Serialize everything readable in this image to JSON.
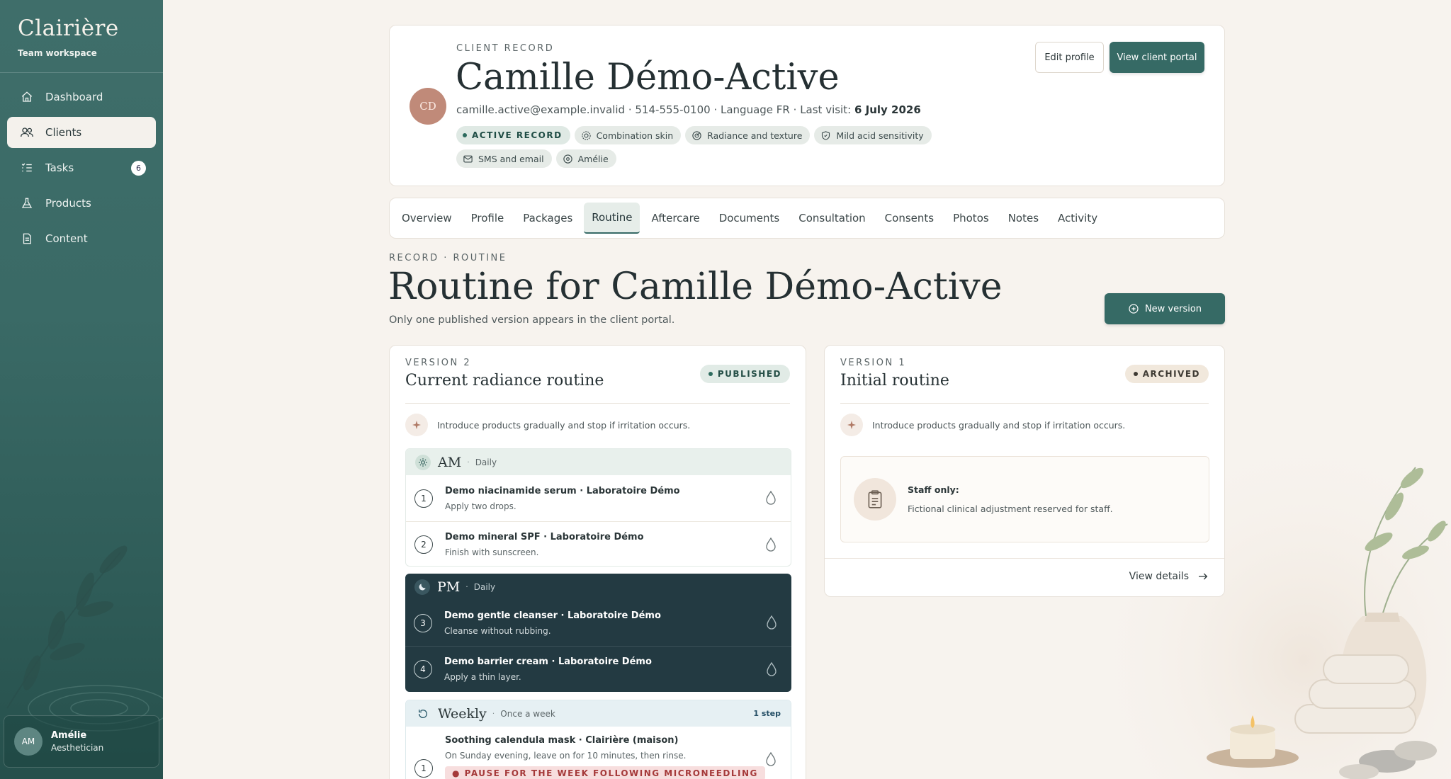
{
  "sidebar": {
    "brand": "Clairière",
    "workspace": "Team workspace",
    "items": [
      {
        "label": "Dashboard",
        "icon": "home-icon"
      },
      {
        "label": "Clients",
        "icon": "users-icon"
      },
      {
        "label": "Tasks",
        "icon": "list-icon",
        "badge": "6"
      },
      {
        "label": "Products",
        "icon": "flask-icon"
      },
      {
        "label": "Content",
        "icon": "document-icon"
      }
    ],
    "user": {
      "initials": "AM",
      "name": "Amélie",
      "role": "Aesthetician"
    }
  },
  "client": {
    "eyebrow": "CLIENT RECORD",
    "initials": "CD",
    "name": "Camille Démo-Active",
    "email": "camille.active@example.invalid",
    "phone": "514-555-0100",
    "language": "Language FR",
    "last_visit_label": "Last visit:",
    "last_visit": "6 July 2026",
    "tags": [
      "ACTIVE RECORD",
      "Combination skin",
      "Radiance and texture",
      "Mild acid sensitivity",
      "SMS and email",
      "Amélie"
    ],
    "edit_label": "Edit profile",
    "portal_label": "View client portal"
  },
  "tabs": [
    "Overview",
    "Profile",
    "Packages",
    "Routine",
    "Aftercare",
    "Documents",
    "Consultation",
    "Consents",
    "Photos",
    "Notes",
    "Activity"
  ],
  "active_tab": "Routine",
  "section": {
    "eyebrow": "RECORD · ROUTINE",
    "title": "Routine for Camille Démo-Active",
    "subtitle": "Only one published version appears in the client portal.",
    "new_version_label": "New version"
  },
  "version2": {
    "eyebrow": "VERSION 2",
    "title": "Current radiance routine",
    "status": "PUBLISHED",
    "note": "Introduce products gradually and stop if irritation occurs.",
    "am": {
      "name": "AM",
      "freq": "Daily",
      "steps": [
        {
          "num": "1",
          "title": "Demo niacinamide serum · Laboratoire Démo",
          "desc": "Apply two drops."
        },
        {
          "num": "2",
          "title": "Demo mineral SPF · Laboratoire Démo",
          "desc": "Finish with sunscreen."
        }
      ]
    },
    "pm": {
      "name": "PM",
      "freq": "Daily",
      "steps": [
        {
          "num": "3",
          "title": "Demo gentle cleanser · Laboratoire Démo",
          "desc": "Cleanse without rubbing."
        },
        {
          "num": "4",
          "title": "Demo barrier cream · Laboratoire Démo",
          "desc": "Apply a thin layer."
        }
      ]
    },
    "weekly": {
      "name": "Weekly",
      "freq": "Once a week",
      "count": "1 step",
      "steps": [
        {
          "num": "1",
          "title": "Soothing calendula mask · Clairière (maison)",
          "desc": "On Sunday evening, leave on for 10 minutes, then rinse.",
          "warning": "PAUSE FOR THE WEEK FOLLOWING MICRONEEDLING"
        }
      ]
    }
  },
  "version1": {
    "eyebrow": "VERSION 1",
    "title": "Initial routine",
    "status": "ARCHIVED",
    "note": "Introduce products gradually and stop if irritation occurs.",
    "staff_title": "Staff only:",
    "staff_desc": "Fictional clinical adjustment reserved for staff.",
    "details_label": "View details"
  },
  "colors": {
    "accent": "#366a65",
    "sidebar": "#3f6e6a",
    "pm_block": "#233a42",
    "warning_bg": "#f7dede",
    "warning_text": "#a53a3a"
  }
}
